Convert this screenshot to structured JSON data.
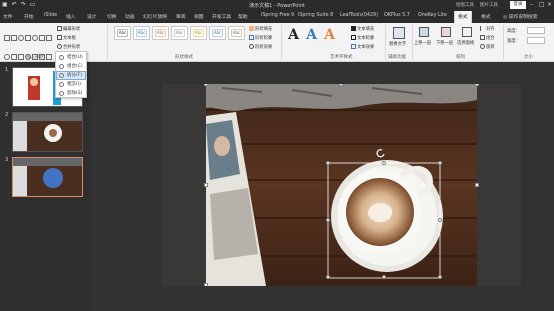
{
  "window": {
    "title": "演示文稿1 - PowerPoint",
    "context_tabs": [
      "绘图工具",
      "图片工具"
    ],
    "login_label": "登录"
  },
  "quick_access": [
    "save-icon",
    "undo-icon",
    "redo-icon",
    "present-icon"
  ],
  "tabs": [
    {
      "label": "文件"
    },
    {
      "label": "开始"
    },
    {
      "label": "iSlide"
    },
    {
      "label": "插入"
    },
    {
      "label": "设计"
    },
    {
      "label": "切换"
    },
    {
      "label": "动画"
    },
    {
      "label": "幻灯片放映"
    },
    {
      "label": "审阅"
    },
    {
      "label": "视图"
    },
    {
      "label": "开发工具"
    },
    {
      "label": "帮助"
    },
    {
      "label": "iSpring Free 9"
    },
    {
      "label": "iSpring Suite 8"
    },
    {
      "label": "LeafTools(0429)"
    },
    {
      "label": "OKPlus 5.7"
    },
    {
      "label": "OneKey Lite"
    },
    {
      "label": "格式"
    },
    {
      "label": "格式"
    }
  ],
  "tell_me": "操作说明搜索",
  "ribbon": {
    "insert_shapes": {
      "label": "插入形状",
      "edit_shape": "编辑形状",
      "text_box": "文本框",
      "merge_shapes": "合并形状"
    },
    "shape_styles": {
      "label": "形状样式",
      "styles": [
        "Abc",
        "Abc",
        "Abc",
        "Abc",
        "Abc",
        "Abc",
        "Abc"
      ],
      "fill": "形状填充",
      "outline": "形状轮廓",
      "effects": "形状效果"
    },
    "wordart": {
      "label": "艺术字样式",
      "letters": [
        "A",
        "A",
        "A"
      ],
      "text_fill": "文本填充",
      "text_outline": "文本轮廓",
      "text_effects": "文本效果"
    },
    "accessibility": {
      "label": "辅助功能",
      "alt_text": "替换文字"
    },
    "arrange": {
      "label": "排列",
      "bring_forward": "上移一层",
      "send_backward": "下移一层",
      "selection_pane": "选择窗格",
      "align": "对齐",
      "group": "组合",
      "rotate": "旋转"
    },
    "size": {
      "label": "大小",
      "height_label": "高度:",
      "width_label": "宽度:"
    }
  },
  "merge_menu": {
    "items": [
      "结合(U)",
      "组合(C)",
      "拆分(F)",
      "相交(I)",
      "剪除(S)"
    ],
    "highlighted_index": 2
  },
  "slides": [
    {
      "number": "1"
    },
    {
      "number": "2"
    },
    {
      "number": "3",
      "selected": true
    }
  ],
  "colors": {
    "accent": "#d98b6a",
    "menu_highlight": "#d6e8f7",
    "thumb_circle": "#4472c4",
    "thumb1_red": "#c0392b",
    "thumb1_blue": "#1da1d6"
  }
}
